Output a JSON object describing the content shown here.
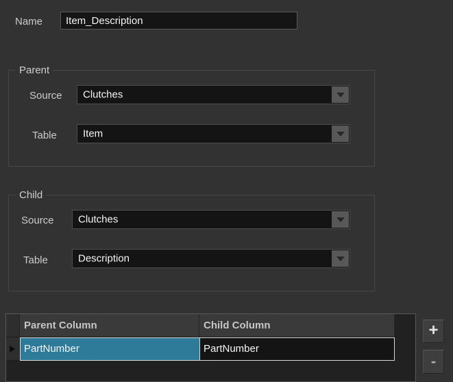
{
  "form": {
    "name_label": "Name",
    "name_value": "Item_Description",
    "parent_group": {
      "title": "Parent",
      "source_label": "Source",
      "source_value": "Clutches",
      "table_label": "Table",
      "table_value": "Item"
    },
    "child_group": {
      "title": "Child",
      "source_label": "Source",
      "source_value": "Clutches",
      "table_label": "Table",
      "table_value": "Description"
    }
  },
  "mapping_grid": {
    "columns": [
      "Parent Column",
      "Child Column"
    ],
    "rows": [
      {
        "parent_column": "PartNumber",
        "child_column": "PartNumber"
      }
    ],
    "selected_row_index": 0,
    "selected_column": "Parent Column"
  },
  "buttons": {
    "add_label": "+",
    "remove_label": "-"
  },
  "colors": {
    "background": "#323232",
    "field_background": "#141414",
    "selection_teal": "#2d7b99",
    "group_border": "#474747"
  }
}
